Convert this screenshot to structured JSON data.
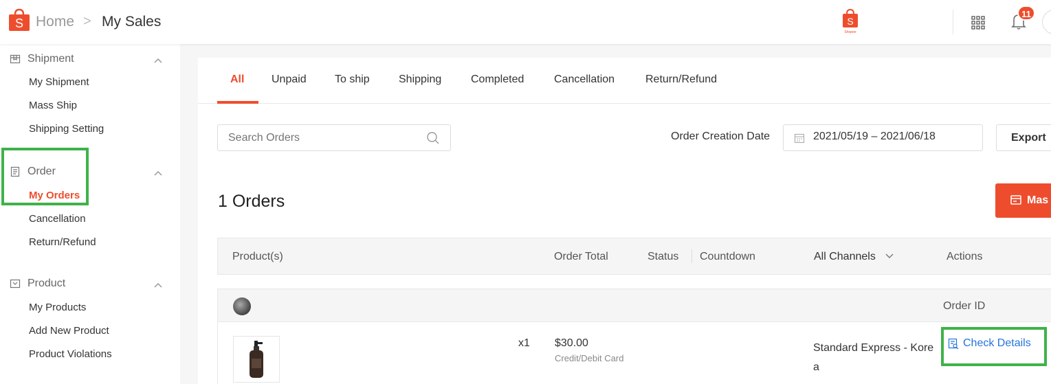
{
  "header": {
    "breadcrumb_home": "Home",
    "breadcrumb_separator": ">",
    "breadcrumb_current": "My Sales",
    "notification_count": "11",
    "center_logo_caption": "Shopee"
  },
  "sidebar": {
    "sections": [
      {
        "title": "Shipment",
        "icon": "shipment-icon",
        "items": [
          "My Shipment",
          "Mass Ship",
          "Shipping Setting"
        ]
      },
      {
        "title": "Order",
        "icon": "order-icon",
        "items": [
          "My Orders",
          "Cancellation",
          "Return/Refund"
        ],
        "active_item": "My Orders"
      },
      {
        "title": "Product",
        "icon": "product-icon",
        "items": [
          "My Products",
          "Add New Product",
          "Product Violations"
        ]
      }
    ]
  },
  "tabs": [
    "All",
    "Unpaid",
    "To ship",
    "Shipping",
    "Completed",
    "Cancellation",
    "Return/Refund"
  ],
  "active_tab": "All",
  "filters": {
    "search_placeholder": "Search Orders",
    "date_label": "Order Creation Date",
    "date_range": "2021/05/19 – 2021/06/18",
    "export_label": "Export"
  },
  "orders_count": "1 Orders",
  "mass_button_label": "Mas",
  "table": {
    "columns": [
      "Product(s)",
      "Order Total",
      "Status",
      "Countdown",
      "All Channels",
      "Actions"
    ],
    "order_id_label": "Order ID"
  },
  "order": {
    "quantity": "x1",
    "total": "$30.00",
    "payment_method": "Credit/Debit Card",
    "shipping_channel": "Standard Express - Korea",
    "action_label": "Check Details"
  },
  "colors": {
    "brand": "#ee4d2d",
    "link": "#2673dd",
    "highlight_box": "#3fb24a"
  }
}
